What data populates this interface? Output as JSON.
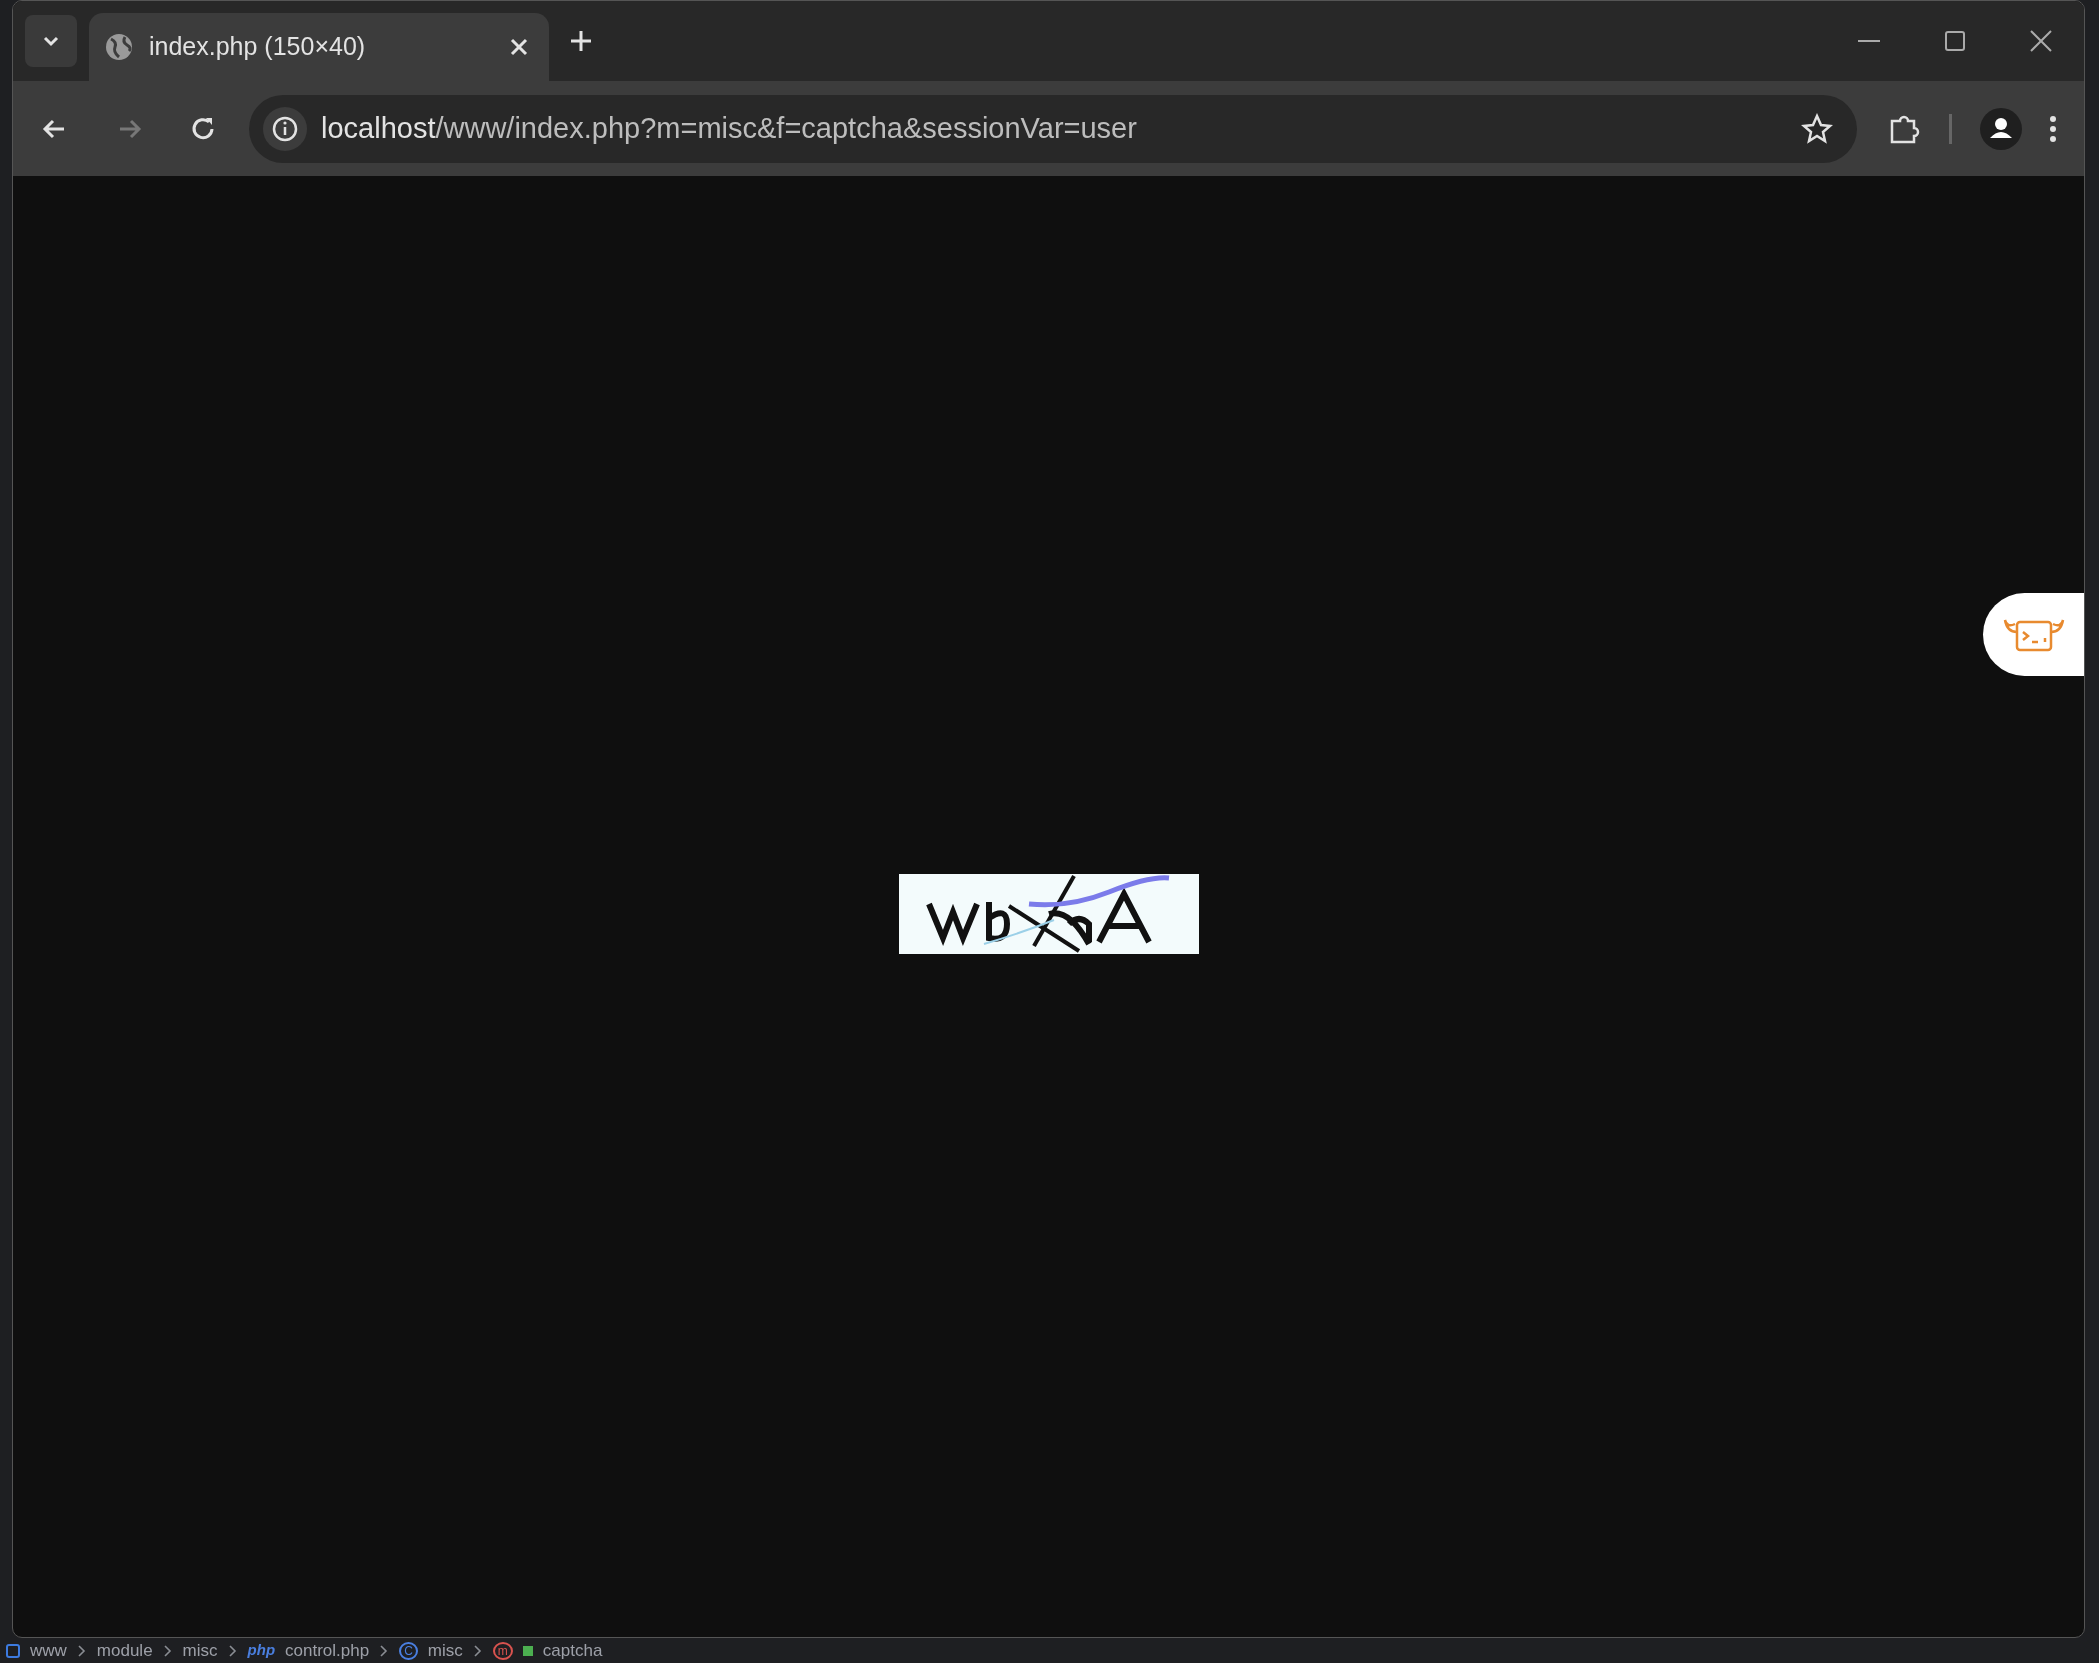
{
  "tabs": [
    {
      "title": "index.php (150×40)",
      "selected": true
    }
  ],
  "toolbar": {
    "nav": [
      {
        "kind": "back",
        "disabled": false
      },
      {
        "kind": "forward",
        "disabled": true
      },
      {
        "kind": "reload",
        "disabled": false
      }
    ]
  },
  "address_bar": {
    "host": "localhost",
    "path": "/www/index.php?m=misc&f=captcha&sessionVar=user"
  },
  "editor_breadcrumbs": [
    {
      "kind": "folder",
      "label": "www"
    },
    {
      "kind": "folder",
      "label": "module"
    },
    {
      "kind": "folder",
      "label": "misc"
    },
    {
      "kind": "php",
      "badge": "php",
      "label": "control.php"
    },
    {
      "kind": "class",
      "badge": "C",
      "label": "misc"
    },
    {
      "kind": "method",
      "badge": "m",
      "label": "captcha"
    }
  ]
}
